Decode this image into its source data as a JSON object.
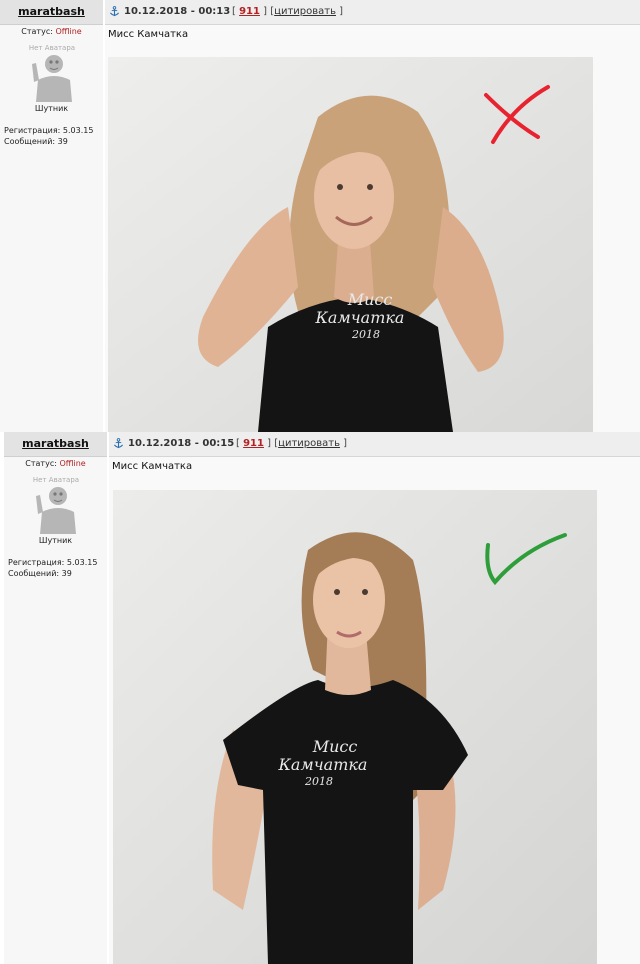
{
  "posts": [
    {
      "author": "maratbash",
      "status_label": "Статус:",
      "status_value": "Offline",
      "avatar_text": "Нет Аватара",
      "rank": "Шутник",
      "registration": "Регистрация: 5.03.15",
      "messages": "Сообщений: 39",
      "date": "10.12.2018 - 00:13",
      "bracket_open": "[",
      "post_number": "911",
      "separator": "] [",
      "quote_label": "цитировать",
      "bracket_close": "]",
      "title": "Мисс Камчатка",
      "shirt_line1": "Мисс",
      "shirt_line2": "Камчатка",
      "shirt_line3": "2018",
      "mark": "cross",
      "mark_color": "#e8232f"
    },
    {
      "author": "maratbash",
      "status_label": "Статус:",
      "status_value": "Offline",
      "avatar_text": "Нет Аватара",
      "rank": "Шутник",
      "registration": "Регистрация: 5.03.15",
      "messages": "Сообщений: 39",
      "date": "10.12.2018 - 00:15",
      "bracket_open": "[",
      "post_number": "911",
      "separator": "] [",
      "quote_label": "цитировать",
      "bracket_close": "]",
      "title": "Мисс Камчатка",
      "shirt_line1": "Мисс",
      "shirt_line2": "Камчатка",
      "shirt_line3": "2018",
      "mark": "check",
      "mark_color": "#2e9e3a"
    }
  ],
  "colors": {
    "header_bg": "#e3e3e3",
    "offline": "#b22222",
    "post_number": "#b22222"
  }
}
